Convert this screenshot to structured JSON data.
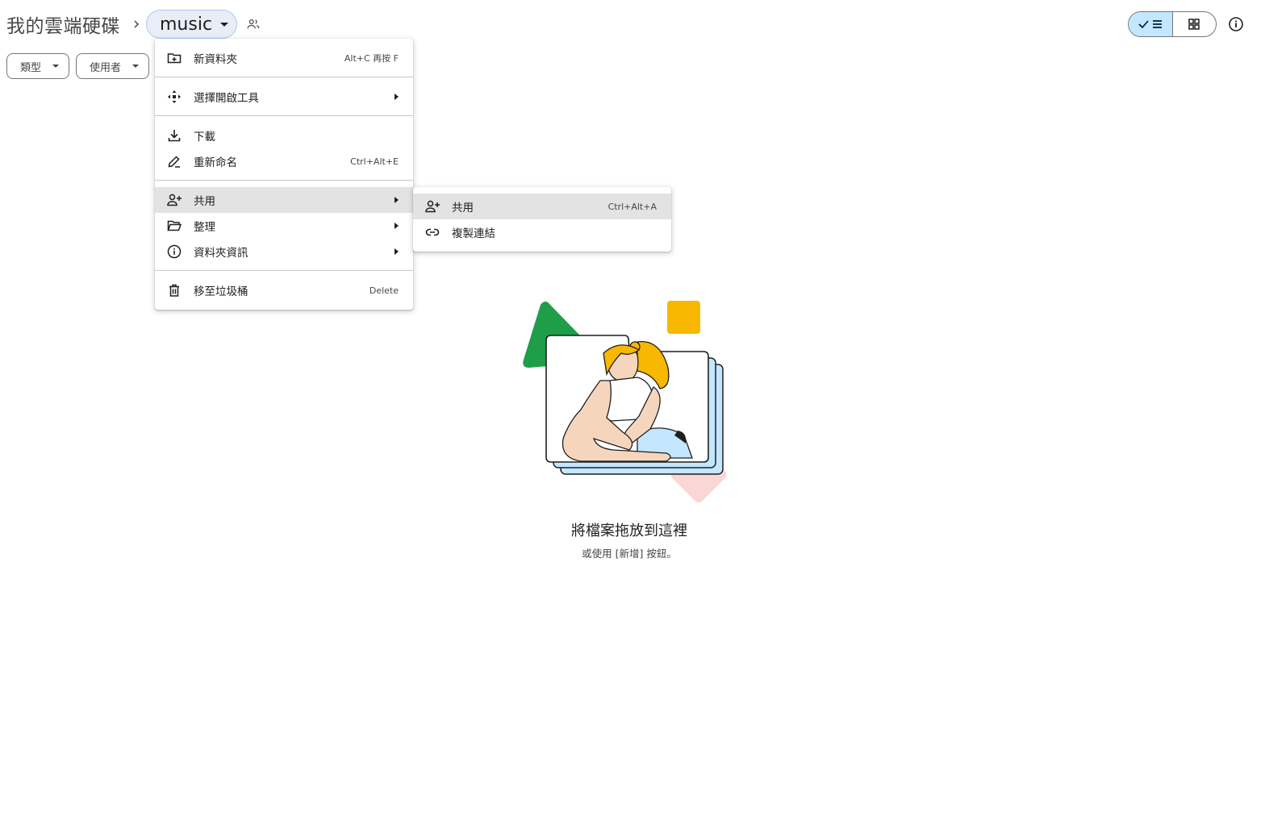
{
  "breadcrumb": {
    "root": "我的雲端硬碟",
    "current": "music"
  },
  "filters": {
    "type": "類型",
    "people": "使用者"
  },
  "context_menu": {
    "items": [
      {
        "label": "新資料夾",
        "shortcut": "Alt+C 再按 F",
        "icon": "new-folder-icon"
      },
      {
        "label": "選擇開啟工具",
        "submenu": true,
        "icon": "open-with-icon"
      },
      {
        "label": "下載",
        "icon": "download-icon"
      },
      {
        "label": "重新命名",
        "shortcut": "Ctrl+Alt+E",
        "icon": "rename-icon"
      },
      {
        "label": "共用",
        "submenu": true,
        "icon": "share-icon",
        "highlighted": true
      },
      {
        "label": "整理",
        "submenu": true,
        "icon": "organize-folder-icon"
      },
      {
        "label": "資料夾資訊",
        "submenu": true,
        "icon": "info-icon"
      },
      {
        "label": "移至垃圾桶",
        "shortcut": "Delete",
        "icon": "trash-icon"
      }
    ]
  },
  "share_submenu": {
    "items": [
      {
        "label": "共用",
        "shortcut": "Ctrl+Alt+A",
        "icon": "share-icon",
        "highlighted": true
      },
      {
        "label": "複製連結",
        "icon": "link-icon"
      }
    ]
  },
  "empty_state": {
    "title": "將檔案拖放到這裡",
    "subtitle": "或使用 [新增] 按鈕。"
  },
  "colors": {
    "accent_light": "#c2e7ff",
    "crumb_bg": "#e9eef6",
    "menu_hover": "#e3e3e3",
    "illustration_green": "#1e9e48",
    "illustration_yellow": "#f8b800",
    "illustration_pink": "#fad7d5",
    "illustration_blue": "#c2e7ff"
  }
}
